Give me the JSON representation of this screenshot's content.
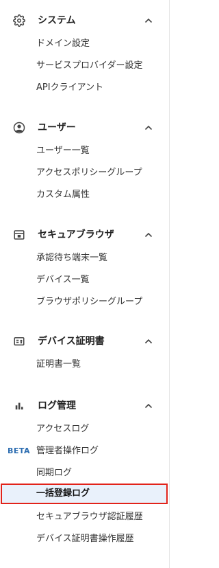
{
  "sections": [
    {
      "title": "システム",
      "icon": "gear-icon",
      "items": [
        {
          "label": "ドメイン設定"
        },
        {
          "label": "サービスプロバイダー設定"
        },
        {
          "label": "APIクライアント"
        }
      ]
    },
    {
      "title": "ユーザー",
      "icon": "user-circle-icon",
      "items": [
        {
          "label": "ユーザー一覧"
        },
        {
          "label": "アクセスポリシーグループ"
        },
        {
          "label": "カスタム属性"
        }
      ]
    },
    {
      "title": "セキュアブラウザ",
      "icon": "browser-window-icon",
      "items": [
        {
          "label": "承認待ち端末一覧"
        },
        {
          "label": "デバイス一覧"
        },
        {
          "label": "ブラウザポリシーグループ"
        }
      ]
    },
    {
      "title": "デバイス証明書",
      "icon": "certificate-card-icon",
      "items": [
        {
          "label": "証明書一覧"
        }
      ]
    },
    {
      "title": "ログ管理",
      "icon": "bar-chart-icon",
      "items": [
        {
          "label": "アクセスログ"
        },
        {
          "label": "管理者操作ログ",
          "badge": "BETA"
        },
        {
          "label": "同期ログ"
        },
        {
          "label": "一括登録ログ",
          "active": true
        },
        {
          "label": "セキュアブラウザ認証履歴"
        },
        {
          "label": "デバイス証明書操作履歴"
        }
      ]
    }
  ],
  "colors": {
    "accent_badge": "#2b6cb0",
    "active_bg": "#e9f1fb",
    "active_border": "#e2231a"
  }
}
